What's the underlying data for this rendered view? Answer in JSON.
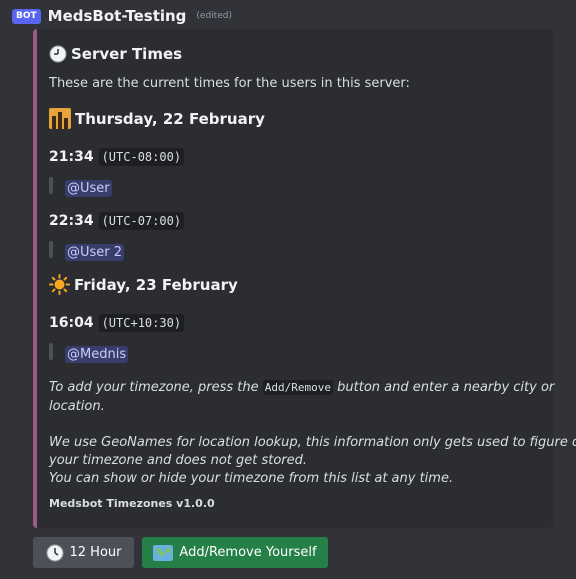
{
  "header": {
    "badge": "BOT",
    "name": "MedsBot-Testing",
    "edited": "(edited)"
  },
  "embed": {
    "accent_color": "#9c5b87",
    "title": "Server Times",
    "title_icon": "clock-icon",
    "description": "These are the current times for the users in this server:",
    "days": [
      {
        "label": "Thursday, 22 February",
        "icon": "night-city-icon",
        "entries": [
          {
            "time": "21:34",
            "offset": "(UTC-08:00)",
            "users": [
              "@User"
            ]
          },
          {
            "time": "22:34",
            "offset": "(UTC-07:00)",
            "users": [
              "@User 2"
            ]
          }
        ]
      },
      {
        "label": "Friday, 23 February",
        "icon": "sun-icon",
        "entries": [
          {
            "time": "16:04",
            "offset": "(UTC+10:30)",
            "users": [
              "@Mednis"
            ]
          }
        ]
      }
    ],
    "instructions": {
      "pre": "To add your timezone, press the ",
      "code": "Add/Remove",
      "post_line1": " button and enter a nearby city or",
      "line2": "location."
    },
    "notes": [
      "We use GeoNames for location lookup, this information only gets used to figure out",
      "your timezone and does not get stored.",
      "You can show or hide your timezone from this list at any time."
    ],
    "footer": "Medsbot Timezones v1.0.0"
  },
  "buttons": {
    "hour_format": {
      "label": "12 Hour",
      "icon": "clock-icon",
      "color": "#4e5058"
    },
    "add_remove": {
      "label": "Add/Remove Yourself",
      "icon": "world-map-icon",
      "color": "#248046"
    }
  }
}
